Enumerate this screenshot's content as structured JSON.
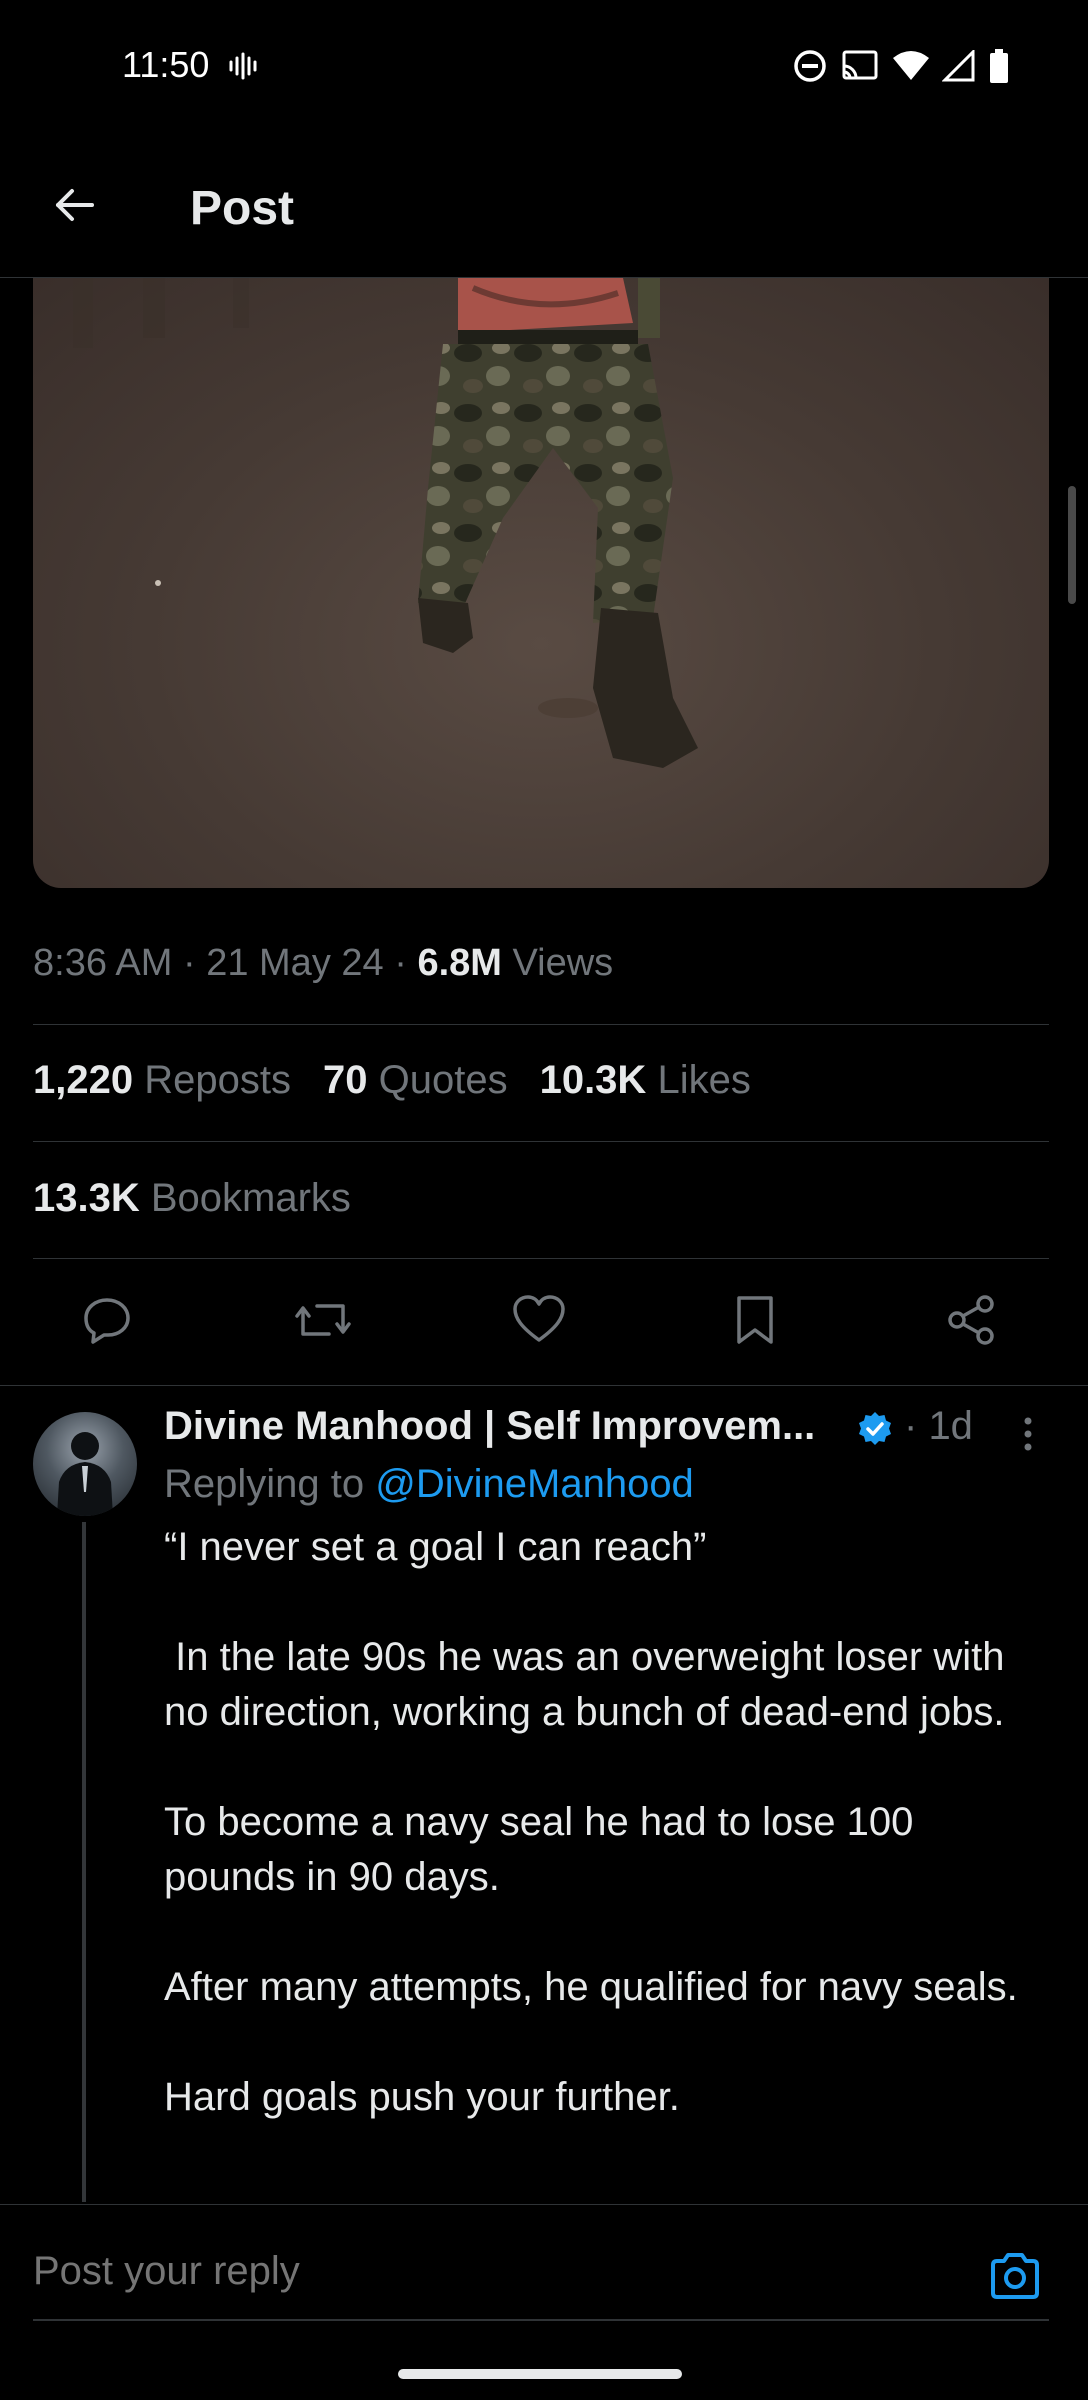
{
  "status_bar": {
    "time": "11:50",
    "icons": [
      "vibrate-icon",
      "do-not-disturb-icon",
      "cast-icon",
      "wifi-icon",
      "cellular-signal-icon",
      "battery-icon"
    ]
  },
  "header": {
    "title": "Post"
  },
  "post": {
    "time": "8:36 AM",
    "date": "21 May 24",
    "views_count": "6.8M",
    "views_label": "Views",
    "reposts_count": "1,220",
    "reposts_label": "Reposts",
    "quotes_count": "70",
    "quotes_label": "Quotes",
    "likes_count": "10.3K",
    "likes_label": "Likes",
    "bookmarks_count": "13.3K",
    "bookmarks_label": "Bookmarks"
  },
  "reply": {
    "author": "Divine Manhood | Self Improvem...",
    "verified": true,
    "time": "1d",
    "replying_to_label": "Replying to",
    "replying_to_handle": "@DivineManhood",
    "body": "“I never set a goal I can reach”\n\n In the late 90s he was an overweight loser with no direction, working a bunch of dead-end jobs.\n\nTo become a navy seal he had to lose 100 pounds in 90 days.\n\nAfter many attempts, he qualified for navy seals.\n\nHard goals push your further."
  },
  "composer": {
    "placeholder": "Post your reply"
  },
  "colors": {
    "background": "#000000",
    "text_primary": "#e7e9ea",
    "text_secondary": "#71767b",
    "accent": "#1d9bf0",
    "divider": "#2f3336"
  }
}
